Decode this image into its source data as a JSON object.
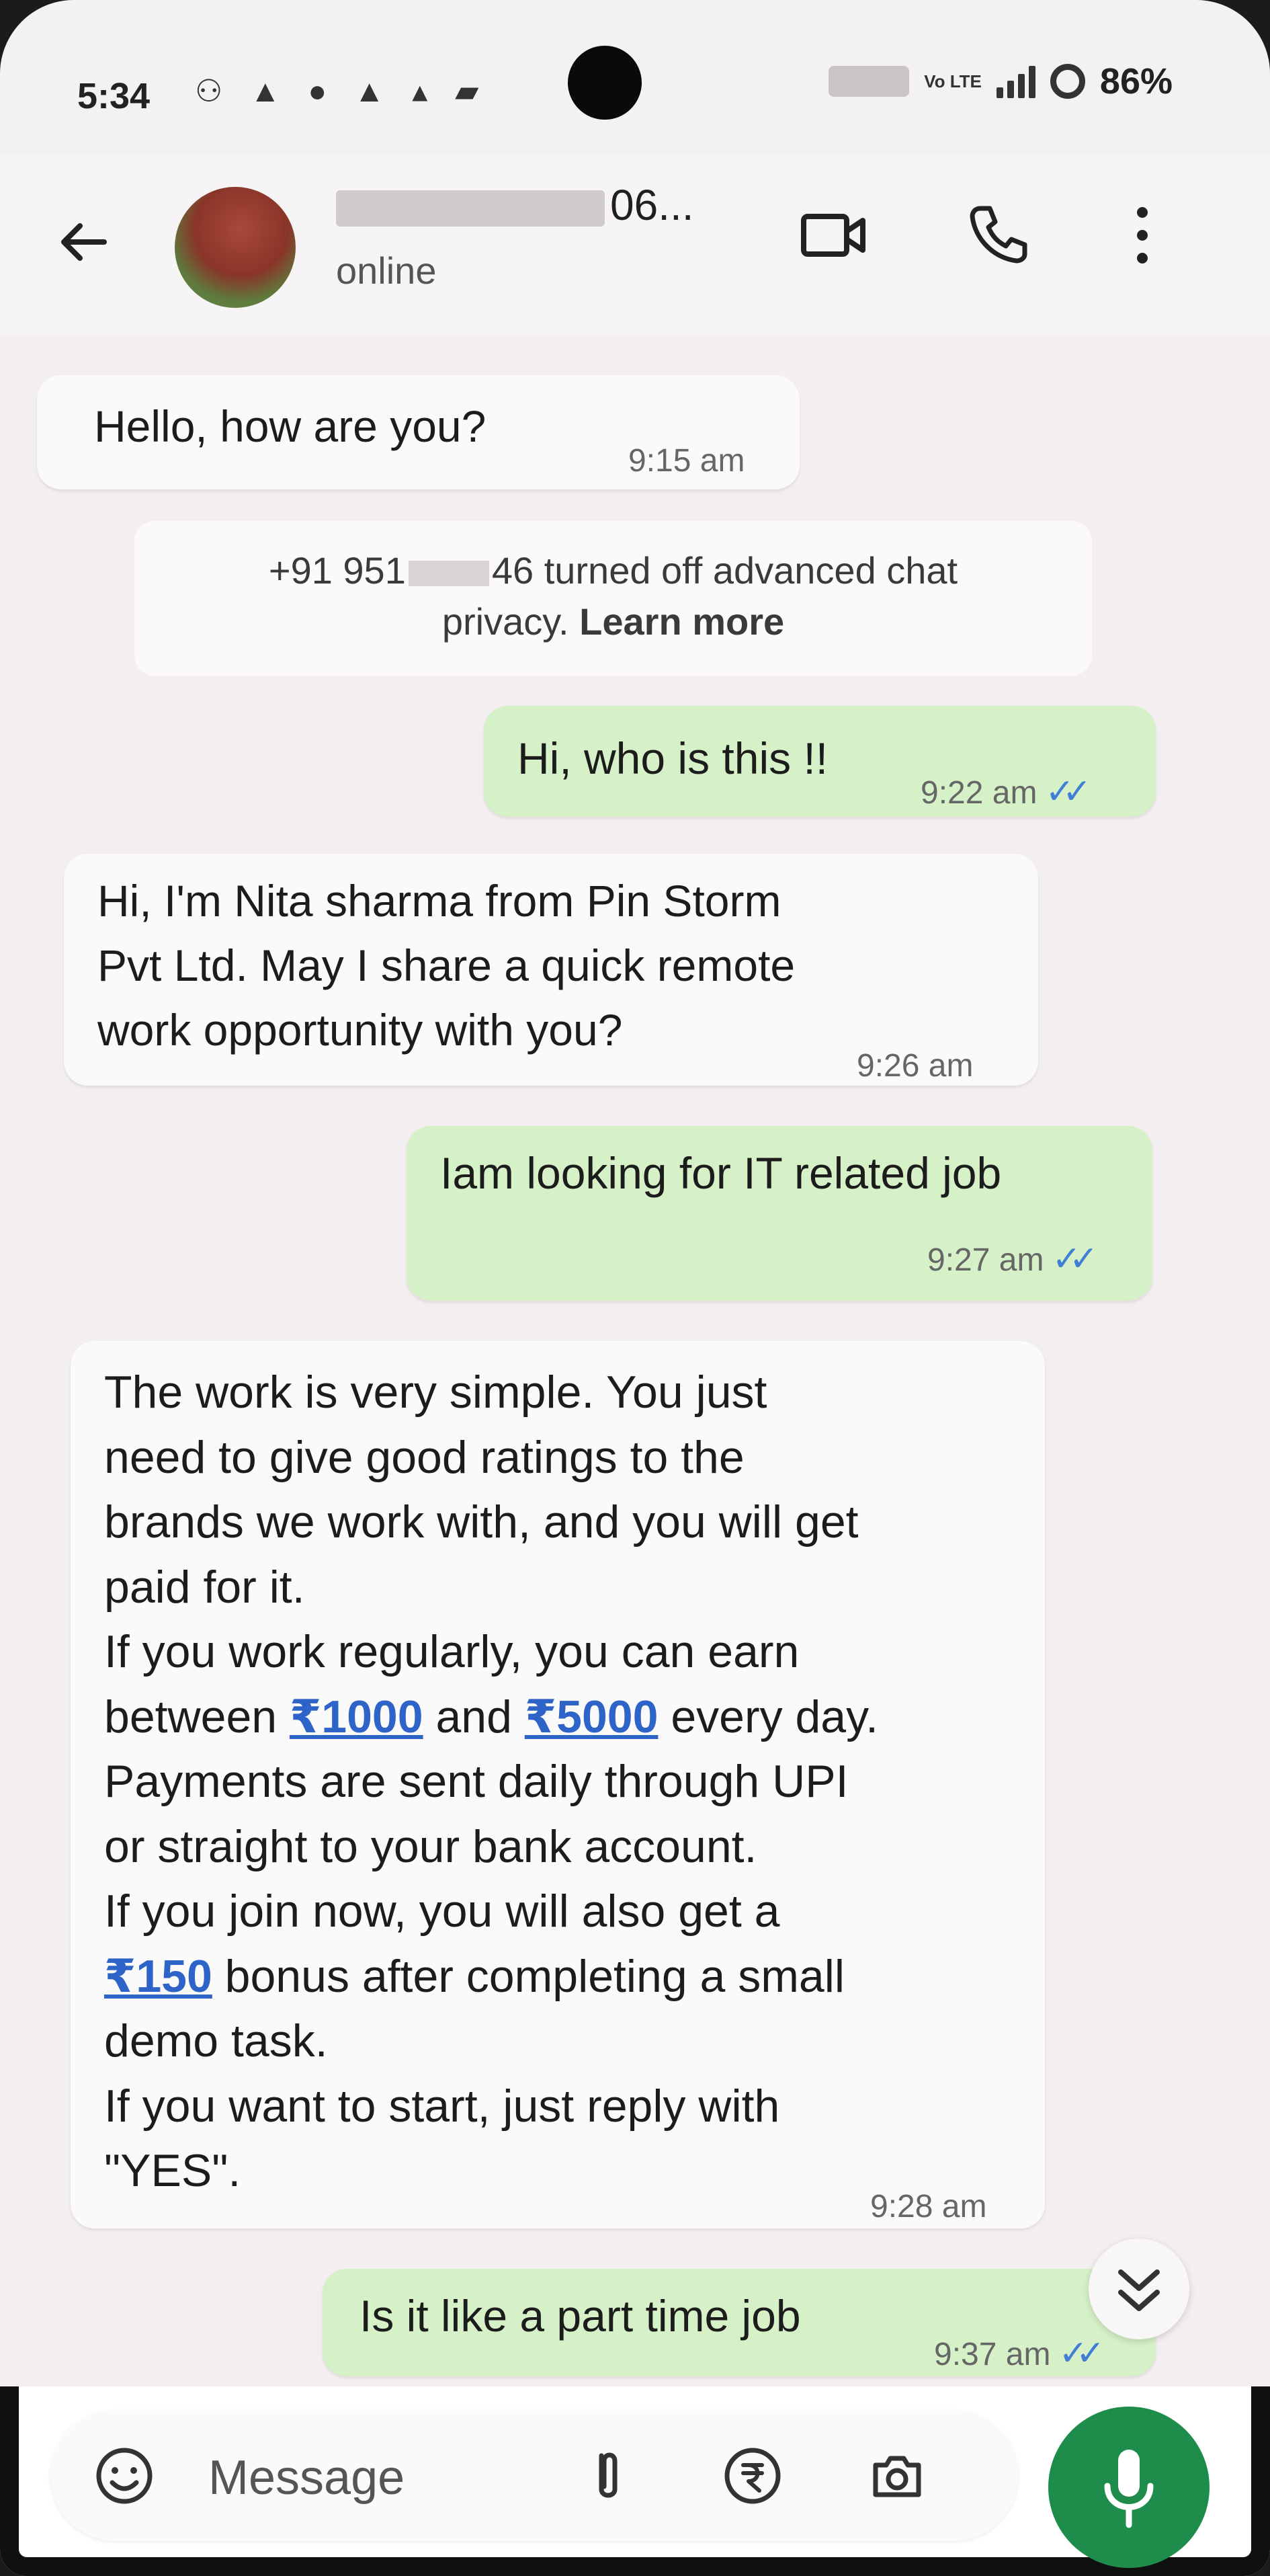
{
  "status_bar": {
    "time": "5:34",
    "network": "Vo LTE",
    "battery": "86%"
  },
  "header": {
    "contact_name": "06...",
    "contact_status": "online",
    "icons": [
      "back-arrow-icon",
      "video-call-icon",
      "voice-call-icon",
      "more-vert-icon"
    ]
  },
  "messages": [
    {
      "direction": "in",
      "text": "Hello, how are you?",
      "time": "9:15 am"
    },
    {
      "direction": "system",
      "text_a": "+91 951",
      "text_b": "46 turned off advanced chat",
      "text_c": "privacy. ",
      "link": "Learn more"
    },
    {
      "direction": "out",
      "text": "Hi, who is this !!",
      "time": "9:22 am",
      "status": "read"
    },
    {
      "direction": "in",
      "lines": [
        "Hi, I'm Nita sharma from Pin Storm",
        "Pvt Ltd. May I share a quick remote",
        "work opportunity with you?"
      ],
      "time": "9:26 am"
    },
    {
      "direction": "out",
      "text": "Iam looking for IT related job",
      "time": "9:27 am",
      "status": "read"
    },
    {
      "direction": "in",
      "time": "9:28 am",
      "l1": "The work is very simple. You just",
      "l2": "need to give good ratings to the",
      "l3": "brands we work with, and you will get",
      "l4": "paid for it.",
      "l5": "If you work regularly, you can earn",
      "l6a": "between ",
      "amount1": "₹1000",
      "l6b": " and ",
      "amount2": "₹5000",
      "l6c": " every day.",
      "l7": "Payments are sent daily through UPI",
      "l8": "or straight to your bank account.",
      "l9": "If you join now, you will also get a",
      "amount3": "₹150",
      "l10b": " bonus after completing a small",
      "l11": "demo task.",
      "l12": "If you want to start, just reply with",
      "l13": "\"YES\"."
    },
    {
      "direction": "out",
      "text": "Is it like a part time job",
      "time": "9:37 am",
      "status": "delivered"
    }
  ],
  "composer": {
    "placeholder": "Message",
    "icons": [
      "emoji-icon",
      "attach-icon",
      "payment-rupee-icon",
      "camera-icon",
      "mic-icon"
    ]
  },
  "colors": {
    "outgoing_bubble": "#d6f0c8",
    "incoming_bubble": "#fbfafa",
    "read_ticks": "#3f7fd6",
    "mic_button": "#1e8c4a"
  }
}
